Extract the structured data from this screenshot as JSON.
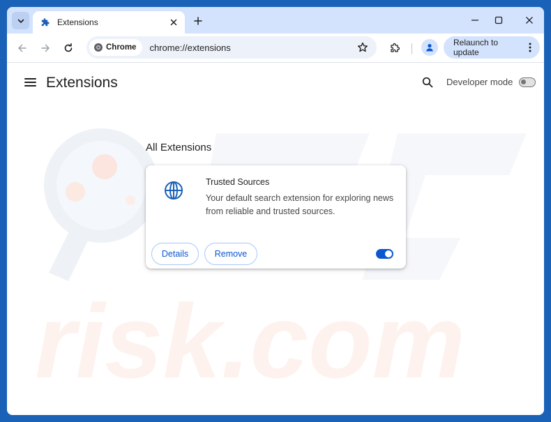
{
  "browser": {
    "tab": {
      "title": "Extensions",
      "favicon": "puzzle-icon",
      "close_icon": "close-icon"
    },
    "tab_search_icon": "chevron-down-icon",
    "new_tab_icon": "plus-icon",
    "window_controls": [
      "minimize-icon",
      "maximize-icon",
      "close-icon"
    ],
    "nav": {
      "back_icon": "back-arrow-icon",
      "forward_icon": "forward-arrow-icon",
      "reload_icon": "reload-icon"
    },
    "omnibox": {
      "chip_label": "Chrome",
      "url": "chrome://extensions",
      "bookmark_icon": "star-icon"
    },
    "extensions_icon": "puzzle-icon",
    "profile_icon": "person-icon",
    "relaunch": {
      "label": "Relaunch to update",
      "menu_icon": "kebab-menu-icon"
    }
  },
  "page": {
    "title": "Extensions",
    "menu_icon": "hamburger-icon",
    "search_icon": "search-icon",
    "developer_mode": {
      "label": "Developer mode",
      "enabled": false
    },
    "section_title": "All Extensions",
    "extensions": [
      {
        "name": "Trusted Sources",
        "description": "Your default search extension for exploring news from reliable and trusted sources.",
        "icon": "globe-icon",
        "details_label": "Details",
        "remove_label": "Remove",
        "enabled": true
      }
    ]
  },
  "colors": {
    "frame": "#d3e3fd",
    "accent": "#0b57d0",
    "outline": "#a8c7fa",
    "background_border": "#1a61b8"
  }
}
